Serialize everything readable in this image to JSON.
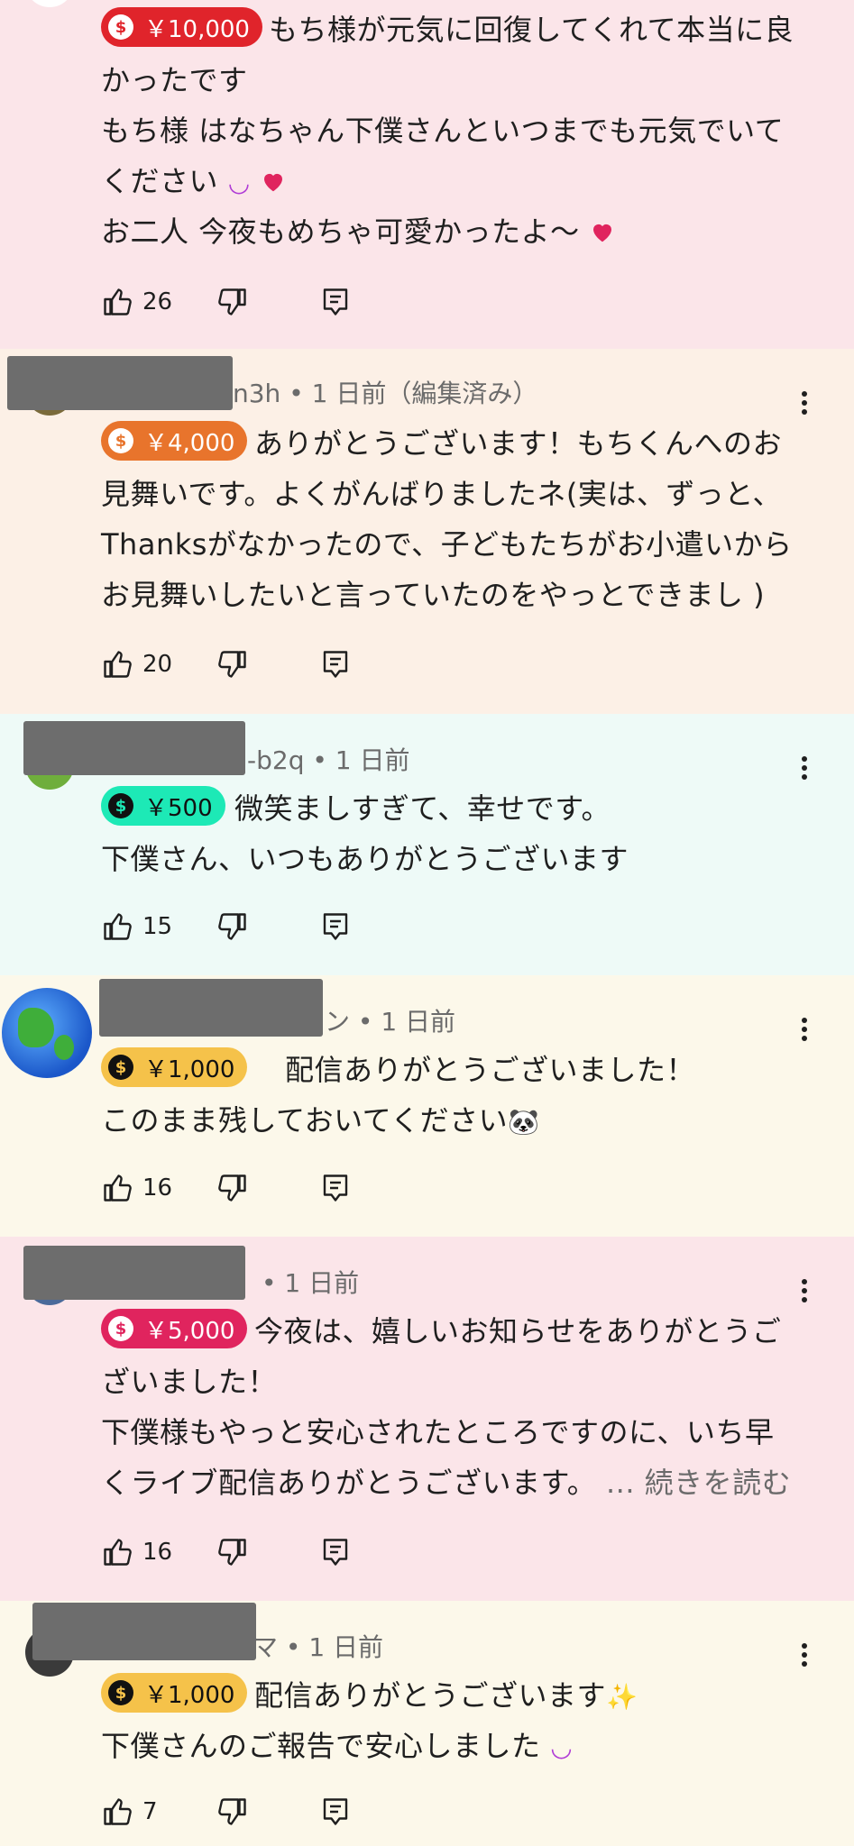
{
  "comments": [
    {
      "chip": "￥10,000",
      "lines": [
        "もち様が元気に回復してくれて本当に良",
        "かったです",
        "もち様 はなちゃん下僕さんといつまでも元気でいて",
        "ください ",
        "お二人 今夜もめちゃ可愛かったよ〜"
      ],
      "likes": "26"
    },
    {
      "meta": "n3h • 1 日前（編集済み）",
      "chip": "￥4,000",
      "lines": [
        "ありがとうございます！もちくんへのお",
        "見舞いです。よくがんばりましたネ(実は、ずっと、",
        "Thanksがなかったので、子どもたちがお小遣いから",
        "お見舞いしたいと言っていたのをやっとできまし )"
      ],
      "likes": "20"
    },
    {
      "meta": "-b2q • 1 日前",
      "chip": "￥500",
      "lines": [
        "微笑ましすぎて、幸せです。",
        "下僕さん、いつもありがとうございます"
      ],
      "likes": "15"
    },
    {
      "meta": "ン • 1 日前",
      "chip": "￥1,000",
      "lines": [
        "配信ありがとうございました！",
        "このまま残しておいてください"
      ],
      "likes": "16"
    },
    {
      "meta": "• 1 日前",
      "chip": "￥5,000",
      "lines": [
        "今夜は、嬉しいお知らせをありがとうご",
        "ざいました！",
        "下僕様もやっと安心されたところですのに、いち早",
        "くライブ配信ありがとうございます。"
      ],
      "more": "... 続きを読む",
      "likes": "16"
    },
    {
      "meta": "マ • 1 日前",
      "chip": "￥1,000",
      "lines": [
        "配信ありがとうございます",
        "下僕さんのご報告で安心しました "
      ],
      "likes": "7"
    }
  ],
  "icons": [
    "thumbs-up-icon",
    "thumbs-down-icon",
    "reply-icon",
    "more-vert-icon"
  ],
  "colors": {
    "red": "#e0242b",
    "orange": "#e8742c",
    "teal": "#1de9b6",
    "yellow": "#f5c24a",
    "pink": "#e0245e"
  }
}
